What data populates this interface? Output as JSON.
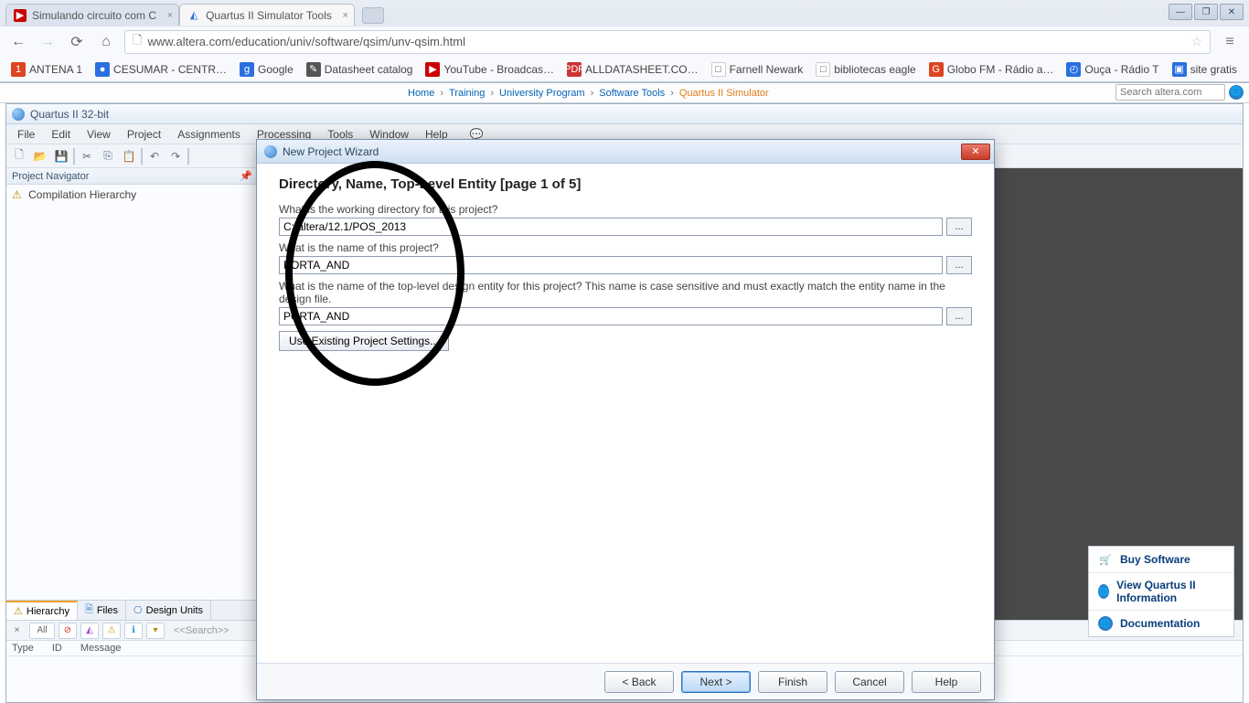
{
  "browser": {
    "tabs": [
      {
        "title": "Simulando circuito com C",
        "favcolor": "#c00"
      },
      {
        "title": "Quartus II Simulator Tools",
        "favcolor": "#2a6fe0"
      }
    ],
    "url": "www.altera.com/education/univ/software/qsim/unv-qsim.html",
    "window_buttons": {
      "min": "—",
      "max": "❐",
      "close": "✕"
    }
  },
  "bookmarks": [
    {
      "label": "ANTENA 1",
      "style": "bi-red",
      "glyph": "1"
    },
    {
      "label": "CESUMAR - CENTR…",
      "style": "bi-blue",
      "glyph": "●"
    },
    {
      "label": "Google",
      "style": "bi-blue",
      "glyph": "g"
    },
    {
      "label": "Datasheet catalog",
      "style": "bi-gray",
      "glyph": "✎"
    },
    {
      "label": "YouTube - Broadcas…",
      "style": "bi-yt",
      "glyph": "▶"
    },
    {
      "label": "ALLDATASHEET.CO…",
      "style": "bi-pdf",
      "glyph": "PDF"
    },
    {
      "label": "Farnell Newark",
      "style": "bi-doc",
      "glyph": "□"
    },
    {
      "label": "bibliotecas eagle",
      "style": "bi-doc",
      "glyph": "□"
    },
    {
      "label": "Globo FM - Rádio a…",
      "style": "bi-red",
      "glyph": "G"
    },
    {
      "label": "Ouça - Rádio T",
      "style": "bi-blue",
      "glyph": "◴"
    },
    {
      "label": "site gratis",
      "style": "bi-blue",
      "glyph": "▣"
    }
  ],
  "crumbs": [
    "Home",
    "Training",
    "University Program",
    "Software Tools",
    "Quartus II Simulator"
  ],
  "search_placeholder": "Search altera.com",
  "quartus": {
    "title": "Quartus II 32-bit",
    "menu": [
      "File",
      "Edit",
      "View",
      "Project",
      "Assignments",
      "Processing",
      "Tools",
      "Window",
      "Help"
    ],
    "nav_title": "Project Navigator",
    "tree_item": "Compilation Hierarchy",
    "nav_tabs": [
      "Hierarchy",
      "Files",
      "Design Units"
    ],
    "msg_search": "<<Search>>",
    "msg_cols": [
      "Type",
      "ID",
      "Message"
    ],
    "msg_all": "All"
  },
  "side_actions": {
    "buy": "Buy Software",
    "info": "View Quartus II Information",
    "doc": "Documentation"
  },
  "modal": {
    "title": "New Project Wizard",
    "heading": "Directory, Name, Top-Level Entity [page 1 of 5]",
    "q_dir": "What is the working directory for this project?",
    "v_dir": "C:/altera/12.1/POS_2013",
    "q_name": "What is the name of this project?",
    "v_name": "PORTA_AND",
    "q_entity": "What is the name of the top-level design entity for this project? This name is case sensitive and must exactly match the entity name in the design file.",
    "v_entity": "PORTA_AND",
    "btn_existing": "Use Existing Project Settings...",
    "browse": "...",
    "footer": {
      "back": "< Back",
      "next": "Next >",
      "finish": "Finish",
      "cancel": "Cancel",
      "help": "Help"
    }
  }
}
